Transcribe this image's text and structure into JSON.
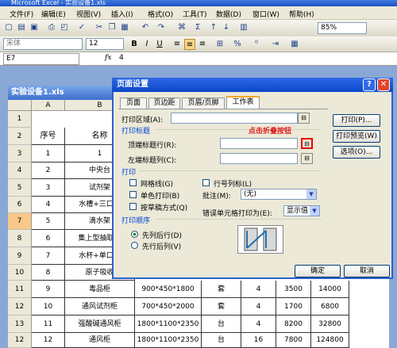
{
  "app": {
    "title": "Microsoft Excel - 实验设备1.xls"
  },
  "menu": [
    "文件(F)",
    "编辑(E)",
    "视图(V)",
    "插入(I)",
    "格式(O)",
    "工具(T)",
    "数据(D)",
    "窗口(W)",
    "帮助(H)"
  ],
  "toolbar": {
    "zoom": "85%",
    "font": "宋体",
    "size": "12"
  },
  "formula_bar": {
    "name_box": "E7",
    "fx": "fx",
    "value": "4"
  },
  "workbook": {
    "title": "实验设备1.xls"
  },
  "sheet": {
    "col_headers": [
      "A",
      "B"
    ],
    "row_numbers": [
      "1",
      "2",
      "3",
      "4",
      "5",
      "6",
      "7",
      "8",
      "9",
      "10",
      "11",
      "12",
      "13"
    ],
    "col_b_header": "名称",
    "col_a_header": "序号",
    "rows_partial": [
      {
        "a": "1",
        "b": "1"
      },
      {
        "a": "2",
        "b": "中央台"
      },
      {
        "a": "3",
        "b": "试剂架"
      },
      {
        "a": "4",
        "b": "水槽+三口水"
      },
      {
        "a": "5",
        "b": "滴水架"
      },
      {
        "a": "6",
        "b": "集上型抽取式"
      },
      {
        "a": "7",
        "b": "水杯+单口水"
      },
      {
        "a": "8",
        "b": "原子吸收"
      }
    ],
    "rows_full": [
      {
        "a": "9",
        "b": "毒品柜",
        "c": "900*450*1800",
        "d": "套",
        "e": "4",
        "f": "3500",
        "g": "14000"
      },
      {
        "a": "10",
        "b": "通风试剂柜",
        "c": "700*450*2000",
        "d": "套",
        "e": "4",
        "f": "1700",
        "g": "6800"
      },
      {
        "a": "11",
        "b": "强酸碱通风柜",
        "c": "1800*1100*2350",
        "d": "台",
        "e": "4",
        "f": "8200",
        "g": "32800"
      },
      {
        "a": "12",
        "b": "通风柜",
        "c": "1800*1100*2350",
        "d": "台",
        "e": "16",
        "f": "7800",
        "g": "124800"
      }
    ]
  },
  "dialog": {
    "title": "页面设置",
    "tabs": [
      "页面",
      "页边距",
      "页眉/页脚",
      "工作表"
    ],
    "print_area_label": "打印区域(A):",
    "print_titles_group": "打印标题",
    "rows_repeat_label": "顶端标题行(R):",
    "cols_repeat_label": "左端标题列(C):",
    "annotation": "点击折叠按钮",
    "print_group": "打印",
    "gridlines": "网格线(G)",
    "row_col_headings": "行号列标(L)",
    "black_white": "单色打印(B)",
    "comments_label": "批注(M):",
    "comments_value": "(无)",
    "draft": "按草稿方式(Q)",
    "errors_label": "错误单元格打印为(E):",
    "errors_value": "显示值",
    "order_group": "打印顺序",
    "down_then_over": "先列后行(D)",
    "over_then_down": "先行后列(V)",
    "btn_print": "打印(P)...",
    "btn_preview": "打印预览(W)",
    "btn_options": "选项(O)...",
    "btn_ok": "确定",
    "btn_cancel": "取消"
  }
}
